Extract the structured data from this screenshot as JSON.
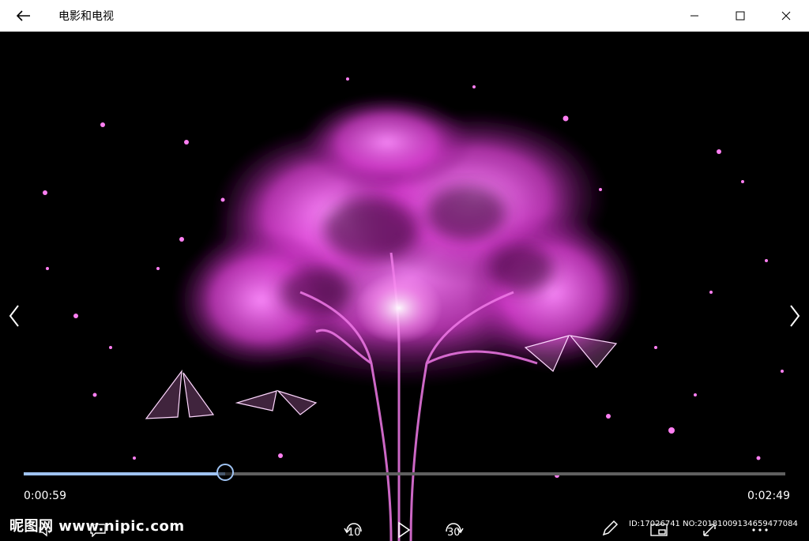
{
  "titlebar": {
    "app_title": "电影和电视",
    "back_icon": "arrow-left-icon",
    "minimize_icon": "minimize-icon",
    "maximize_icon": "maximize-icon",
    "close_icon": "close-icon"
  },
  "player": {
    "prev_icon": "chevron-left-icon",
    "next_icon": "chevron-right-icon",
    "current_time": "0:00:59",
    "total_time": "0:02:49",
    "progress_fraction": 0.265,
    "skip_back_label": "10",
    "skip_forward_label": "30",
    "accent_color": "#9fc3f2",
    "controls": {
      "volume_icon": "volume-icon",
      "subtitles_icon": "subtitles-icon",
      "skip_back_icon": "skip-back-icon",
      "play_icon": "play-icon",
      "skip_forward_icon": "skip-forward-icon",
      "edit_icon": "pencil-icon",
      "mini_view_icon": "mini-view-icon",
      "fullscreen_icon": "fullscreen-icon",
      "more_icon": "more-icon"
    }
  },
  "watermark": {
    "brand": "昵图网 www.nipic.com",
    "id_text": "ID:17026741 NO:20181009134659477084"
  }
}
